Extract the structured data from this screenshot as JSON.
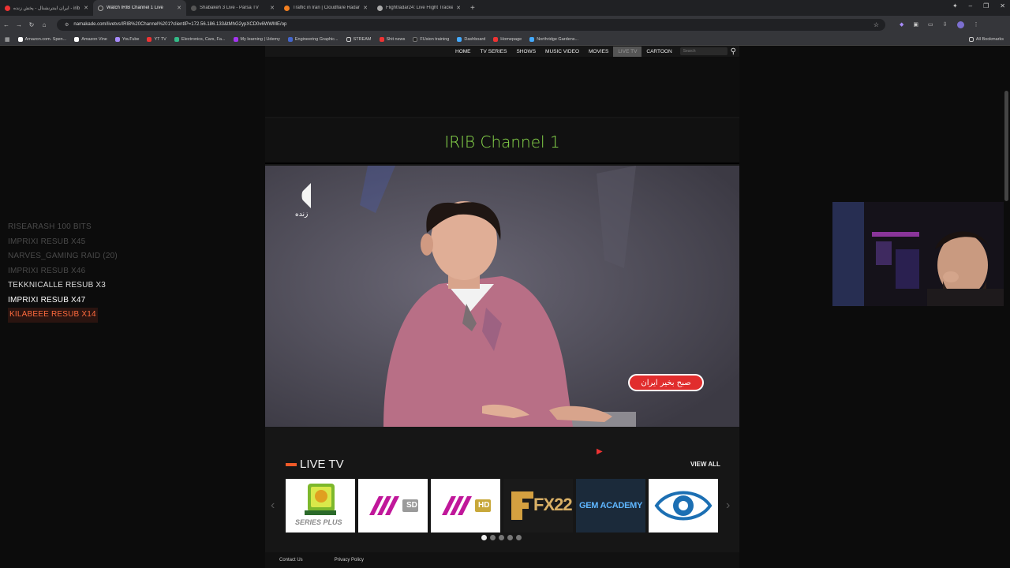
{
  "browser": {
    "tabs": [
      {
        "title": "ایران اینترنشنال - پخش زنده - irib",
        "active": false
      },
      {
        "title": "Watch IRIB Channel 1 Live",
        "active": true
      },
      {
        "title": "Shabakeh 3 Live - Parsa TV",
        "active": false
      },
      {
        "title": "Traffic in Iran | Cloudflare Radar",
        "active": false
      },
      {
        "title": "Flightradar24: Live Flight Tracker",
        "active": false
      }
    ],
    "url": "namakade.com/livetvs/IRIB%20Channel%201?clientIP=172.56.186.133&tMhG2ypXCD0v6WWME/op",
    "bookmarks": [
      "Amazon.com. Spen...",
      "Amazon Vine",
      "YouTube",
      "YT TV",
      "Electronics, Cars, Fa...",
      "My learning | Udemy",
      "Engineering Graphic...",
      "STREAM",
      "Shit news",
      "FUsion training",
      "Dashboard",
      "Homepage",
      "Northridge Gardens..."
    ],
    "all_bookmarks": "All Bookmarks"
  },
  "site": {
    "nav": [
      "HOME",
      "TV SERIES",
      "SHOWS",
      "MUSIC VIDEO",
      "MOVIES",
      "LIVE TV",
      "CARTOON"
    ],
    "current_nav": "LIVE TV",
    "search_placeholder": "Search",
    "channel_title": "IRIB Channel 1",
    "player": {
      "live_logo_text": "زنده",
      "show_banner": "صبح بخیر ایران"
    },
    "live_tv_heading": "LIVE TV",
    "view_all": "VIEW ALL",
    "channels": [
      {
        "name": "SERIES PLUS",
        "logo": "tv-monitor-icon",
        "bg": "#ffffff"
      },
      {
        "name": "SD",
        "logo": "three-stripes-icon",
        "bg": "#ffffff"
      },
      {
        "name": "HD",
        "logo": "three-stripes-icon",
        "bg": "#ffffff"
      },
      {
        "name": "FX22",
        "logo": "fx-icon",
        "bg": "#1a1a1a"
      },
      {
        "name": "GEM ACADEMY",
        "logo": "gem-icon",
        "bg": "#1b2a3a"
      },
      {
        "name": "",
        "logo": "eye-icon",
        "bg": "#ffffff"
      }
    ],
    "carousel_pages": 5,
    "carousel_current": 1,
    "footer": [
      "Contact Us",
      "Privacy Policy"
    ]
  },
  "overlay": {
    "chat": [
      {
        "text": "RISEARASH  100 BITS",
        "color": "#4a4a4a"
      },
      {
        "text": "IMPRIXI  RESUB X45",
        "color": "#4a4a4a"
      },
      {
        "text": "NARVES_GAMING  RAID (20)",
        "color": "#4a4a4a"
      },
      {
        "text": "IMPRIXI  RESUB X46",
        "color": "#4a4a4a"
      },
      {
        "text": "TEKKNICALLE  RESUB X3",
        "color": "#dddddd"
      },
      {
        "text": "IMPRIXI  RESUB X47",
        "color": "#ffffff"
      },
      {
        "text": "KILABEEE  RESUB X14",
        "color": "#ff6a3d"
      }
    ]
  },
  "colors": {
    "accent": "#8adb4c",
    "live_bar": "#f05a28"
  }
}
